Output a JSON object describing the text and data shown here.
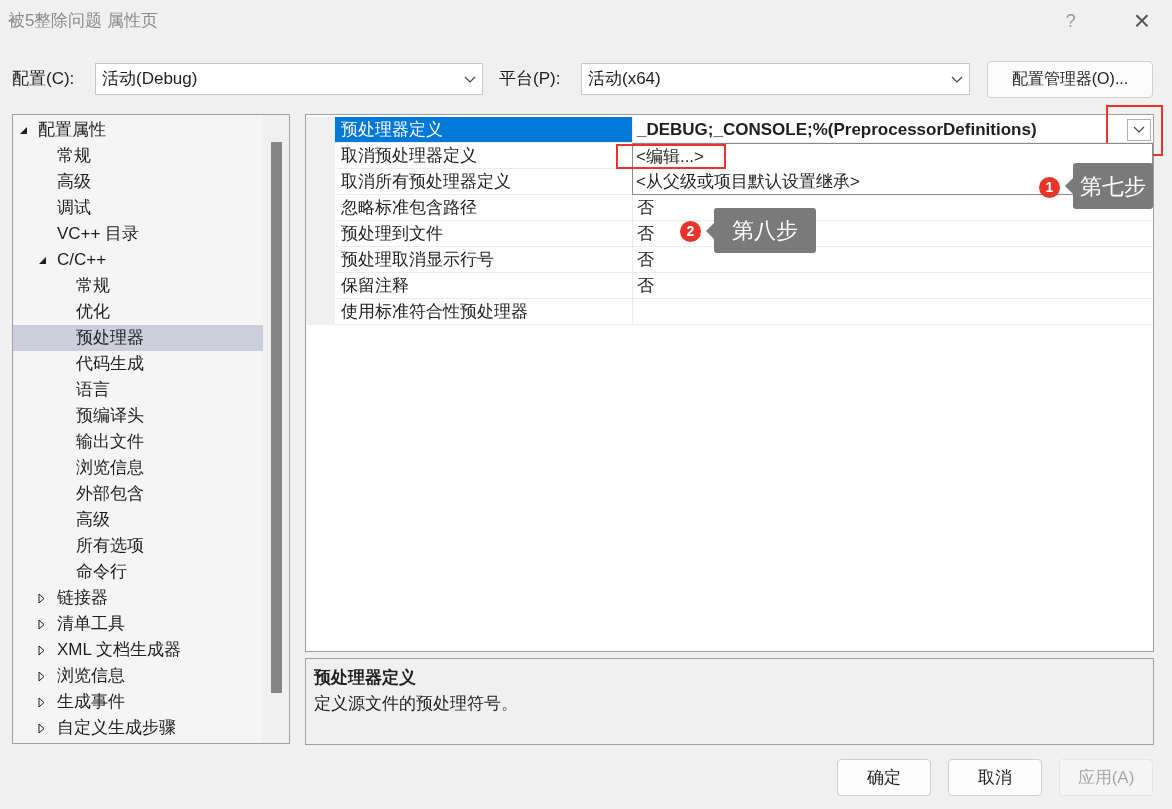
{
  "window": {
    "title": "被5整除问题 属性页",
    "help": "?",
    "close": "×"
  },
  "config": {
    "label": "配置(C):",
    "value": "活动(Debug)"
  },
  "platform": {
    "label": "平台(P):",
    "value": "活动(x64)"
  },
  "config_manager_button": "配置管理器(O)...",
  "tree": [
    {
      "label": "配置属性",
      "expanded": true,
      "selected": false,
      "children": [
        {
          "label": "常规",
          "selected": false
        },
        {
          "label": "高级",
          "selected": false
        },
        {
          "label": "调试",
          "selected": false
        },
        {
          "label": "VC++ 目录",
          "selected": false
        },
        {
          "label": "C/C++",
          "expanded": true,
          "selected": false,
          "children": [
            {
              "label": "常规",
              "selected": false
            },
            {
              "label": "优化",
              "selected": false
            },
            {
              "label": "预处理器",
              "selected": true
            },
            {
              "label": "代码生成",
              "selected": false
            },
            {
              "label": "语言",
              "selected": false
            },
            {
              "label": "预编译头",
              "selected": false
            },
            {
              "label": "输出文件",
              "selected": false
            },
            {
              "label": "浏览信息",
              "selected": false
            },
            {
              "label": "外部包含",
              "selected": false
            },
            {
              "label": "高级",
              "selected": false
            },
            {
              "label": "所有选项",
              "selected": false
            },
            {
              "label": "命令行",
              "selected": false
            }
          ]
        },
        {
          "label": "链接器",
          "expanded": false,
          "selected": false
        },
        {
          "label": "清单工具",
          "expanded": false,
          "selected": false
        },
        {
          "label": "XML 文档生成器",
          "expanded": false,
          "selected": false
        },
        {
          "label": "浏览信息",
          "expanded": false,
          "selected": false
        },
        {
          "label": "生成事件",
          "expanded": false,
          "selected": false
        },
        {
          "label": "自定义生成步骤",
          "expanded": false,
          "selected": false
        }
      ]
    }
  ],
  "properties": [
    {
      "name": "预处理器定义",
      "value": "_DEBUG;_CONSOLE;%(PreprocessorDefinitions)",
      "selected": true
    },
    {
      "name": "取消预处理器定义",
      "selected": false
    },
    {
      "name": "取消所有预处理器定义",
      "selected": false
    },
    {
      "name": "忽略标准包含路径",
      "value": "否",
      "selected": false
    },
    {
      "name": "预处理到文件",
      "value": "否",
      "selected": false
    },
    {
      "name": "预处理取消显示行号",
      "value": "否",
      "selected": false
    },
    {
      "name": "保留注释",
      "value": "否",
      "selected": false
    },
    {
      "name": "使用标准符合性预处理器",
      "selected": false
    }
  ],
  "dropdown": {
    "button_highlighted": true,
    "options": [
      {
        "label": "<编辑...>",
        "highlighted": true
      },
      {
        "label": "<从父级或项目默认设置继承>",
        "highlighted": false
      }
    ]
  },
  "description": {
    "title": "预处理器定义",
    "text": "定义源文件的预处理符号。"
  },
  "buttons": [
    {
      "label": "确定",
      "disabled": false
    },
    {
      "label": "取消",
      "disabled": false
    },
    {
      "label": "应用(A)",
      "disabled": true
    }
  ],
  "annotations": [
    {
      "number": "1",
      "label": "第七步"
    },
    {
      "number": "2",
      "label": "第八步"
    }
  ]
}
